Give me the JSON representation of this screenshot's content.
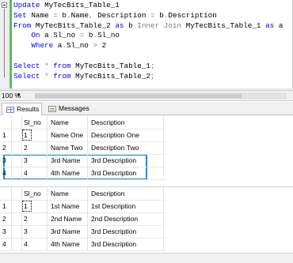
{
  "editor": {
    "lines": [
      [
        {
          "t": "Update ",
          "c": "kw"
        },
        {
          "t": "MyTecBits_Table_1",
          "c": "id"
        }
      ],
      [
        {
          "t": "Set ",
          "c": "kw"
        },
        {
          "t": "Name ",
          "c": "id"
        },
        {
          "t": "=",
          "c": "gr"
        },
        {
          "t": " b",
          "c": "id"
        },
        {
          "t": ".",
          "c": "gr"
        },
        {
          "t": "Name",
          "c": "id"
        },
        {
          "t": ",",
          "c": "gr"
        },
        {
          "t": " Description ",
          "c": "id"
        },
        {
          "t": "=",
          "c": "gr"
        },
        {
          "t": " b",
          "c": "id"
        },
        {
          "t": ".",
          "c": "gr"
        },
        {
          "t": "Description",
          "c": "id"
        }
      ],
      [
        {
          "t": "From ",
          "c": "kw"
        },
        {
          "t": "MyTecBits_Table_2 ",
          "c": "id"
        },
        {
          "t": "as ",
          "c": "kw"
        },
        {
          "t": "b ",
          "c": "id"
        },
        {
          "t": "Inner Join ",
          "c": "gr"
        },
        {
          "t": "MyTecBits_Table_1 ",
          "c": "id"
        },
        {
          "t": "as ",
          "c": "kw"
        },
        {
          "t": "a",
          "c": "id"
        }
      ],
      [
        {
          "t": "    On ",
          "c": "kw"
        },
        {
          "t": "a",
          "c": "id"
        },
        {
          "t": ".",
          "c": "gr"
        },
        {
          "t": "Sl_no ",
          "c": "id"
        },
        {
          "t": "=",
          "c": "gr"
        },
        {
          "t": " b",
          "c": "id"
        },
        {
          "t": ".",
          "c": "gr"
        },
        {
          "t": "Sl_no",
          "c": "id"
        }
      ],
      [
        {
          "t": "    Where ",
          "c": "kw"
        },
        {
          "t": "a",
          "c": "id"
        },
        {
          "t": ".",
          "c": "gr"
        },
        {
          "t": "Sl_no ",
          "c": "id"
        },
        {
          "t": ">",
          "c": "gr"
        },
        {
          "t": " 2",
          "c": "id"
        }
      ],
      [],
      [
        {
          "t": "Select ",
          "c": "kw"
        },
        {
          "t": "*",
          "c": "gr"
        },
        {
          "t": " from ",
          "c": "kw"
        },
        {
          "t": "MyTecBits_Table_1",
          "c": "id"
        },
        {
          "t": ";",
          "c": "gr"
        }
      ],
      [
        {
          "t": "Select ",
          "c": "kw"
        },
        {
          "t": "*",
          "c": "gr"
        },
        {
          "t": " from ",
          "c": "kw"
        },
        {
          "t": "MyTecBits_Table_2",
          "c": "id"
        },
        {
          "t": ";",
          "c": "gr"
        }
      ]
    ]
  },
  "zoom": {
    "value": "100 %",
    "arrow": "▾"
  },
  "tabs": {
    "results": "Results",
    "messages": "Messages"
  },
  "colors": {
    "keyword": "#0000ff",
    "operator": "#808080",
    "highlight": "#1b8bd6",
    "change_bar": "#5fb85f"
  },
  "grid1": {
    "columns": [
      "Sl_no",
      "Name",
      "Description"
    ],
    "rows": [
      [
        "1",
        "1",
        "Name One",
        "Description One"
      ],
      [
        "2",
        "2",
        "Name Two",
        "Description Two"
      ],
      [
        "3",
        "3",
        "3rd Name",
        "3rd Description"
      ],
      [
        "4",
        "4",
        "4th Name",
        "3rd Description"
      ]
    ]
  },
  "grid2": {
    "columns": [
      "Sl_no",
      "Name",
      "Description"
    ],
    "rows": [
      [
        "1",
        "1",
        "1st Name",
        "1st Description"
      ],
      [
        "2",
        "2",
        "2nd Name",
        "2nd Description"
      ],
      [
        "3",
        "3",
        "3rd Name",
        "3rd Description"
      ],
      [
        "4",
        "4",
        "4th Name",
        "3rd Description"
      ]
    ]
  }
}
